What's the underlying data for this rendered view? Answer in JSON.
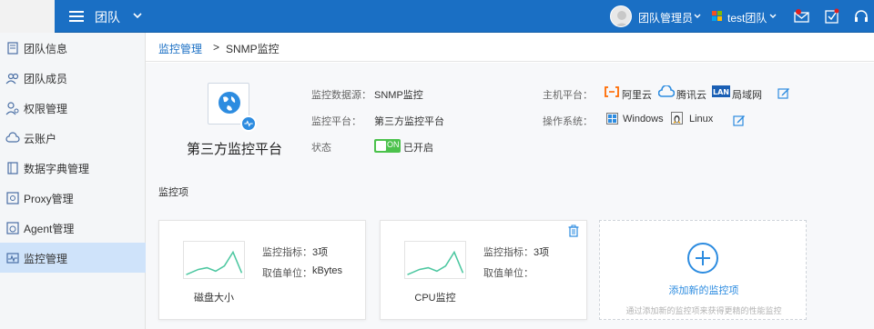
{
  "header": {
    "title": "团队",
    "user_name": "团队管理员",
    "team_name": "test团队"
  },
  "sidebar": {
    "items": [
      {
        "label": "团队信息",
        "icon": "team-info-icon",
        "active": false
      },
      {
        "label": "团队成员",
        "icon": "team-members-icon",
        "active": false
      },
      {
        "label": "权限管理",
        "icon": "permission-icon",
        "active": false
      },
      {
        "label": "云账户",
        "icon": "cloud-account-icon",
        "active": false
      },
      {
        "label": "数据字典管理",
        "icon": "data-dictionary-icon",
        "active": false
      },
      {
        "label": "Proxy管理",
        "icon": "proxy-icon",
        "active": false
      },
      {
        "label": "Agent管理",
        "icon": "agent-icon",
        "active": false
      },
      {
        "label": "监控管理",
        "icon": "monitor-icon",
        "active": true
      }
    ]
  },
  "breadcrumb": {
    "parent": "监控管理",
    "separator": ">",
    "current": "SNMP监控"
  },
  "source": {
    "name": "第三方监控平台",
    "fields": {
      "datasource_label": "监控数据源：",
      "datasource_value": "SNMP监控",
      "platform_label": "监控平台：",
      "platform_value": "第三方监控平台",
      "status_label": "状态",
      "status_toggle": "ON",
      "status_value": "已开启",
      "host_platform_label": "主机平台：",
      "os_label": "操作系统："
    },
    "host_platforms": [
      "阿里云",
      "腾讯云",
      "局域网"
    ],
    "host_platform_icons": [
      "aliyun-icon",
      "tencent-cloud-icon",
      "lan-icon"
    ],
    "os_list": [
      "Windows",
      "Linux"
    ],
    "os_icons": [
      "windows-icon",
      "linux-icon"
    ]
  },
  "items_section": {
    "title": "监控项",
    "cards": [
      {
        "name": "磁盘大小",
        "metric_label": "监控指标：",
        "metric_value": "3项",
        "unit_label": "取值单位：",
        "unit_value": "kBytes"
      },
      {
        "name": "CPU监控",
        "metric_label": "监控指标：",
        "metric_value": "3项",
        "unit_label": "取值单位：",
        "unit_value": ""
      }
    ],
    "add_card": {
      "title": "添加新的监控项",
      "hint": "通过添加新的监控项来获得更精的性能监控"
    }
  },
  "colors": {
    "header_bg": "#1a6fc4",
    "accent": "#2d8ce0",
    "toggle_on": "#4cc24c",
    "active_nav": "#cfe3fa",
    "sparkline": "#4cc7a0"
  }
}
